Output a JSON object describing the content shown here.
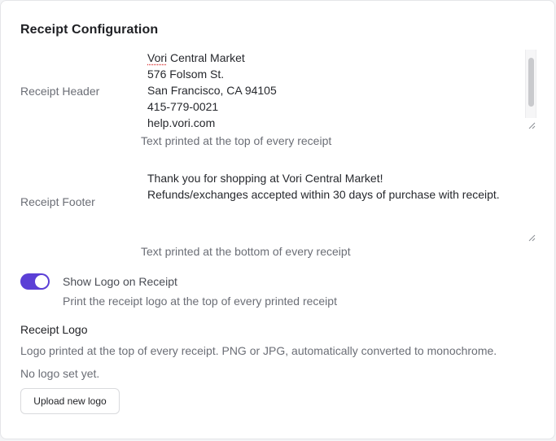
{
  "page": {
    "title": "Receipt Configuration"
  },
  "header_field": {
    "label": "Receipt Header",
    "lines": [
      "Vori Central Market",
      "576 Folsom St.",
      "San Francisco, CA 94105",
      "415-779-0021",
      "help.vori.com"
    ],
    "help": "Text printed at the top of every receipt"
  },
  "footer_field": {
    "label": "Receipt Footer",
    "lines": [
      "Thank you for shopping at Vori Central Market!",
      "Refunds/exchanges accepted within 30 days of purchase with receipt."
    ],
    "help": "Text printed at the bottom of every receipt"
  },
  "logo_toggle": {
    "label": "Show Logo on Receipt",
    "help": "Print the receipt logo at the top of every printed receipt",
    "enabled": true,
    "color": "#5b3fd6"
  },
  "logo_section": {
    "title": "Receipt Logo",
    "help": "Logo printed at the top of every receipt. PNG or JPG, automatically converted to monochrome.",
    "empty_text": "No logo set yet.",
    "upload_label": "Upload new logo"
  }
}
